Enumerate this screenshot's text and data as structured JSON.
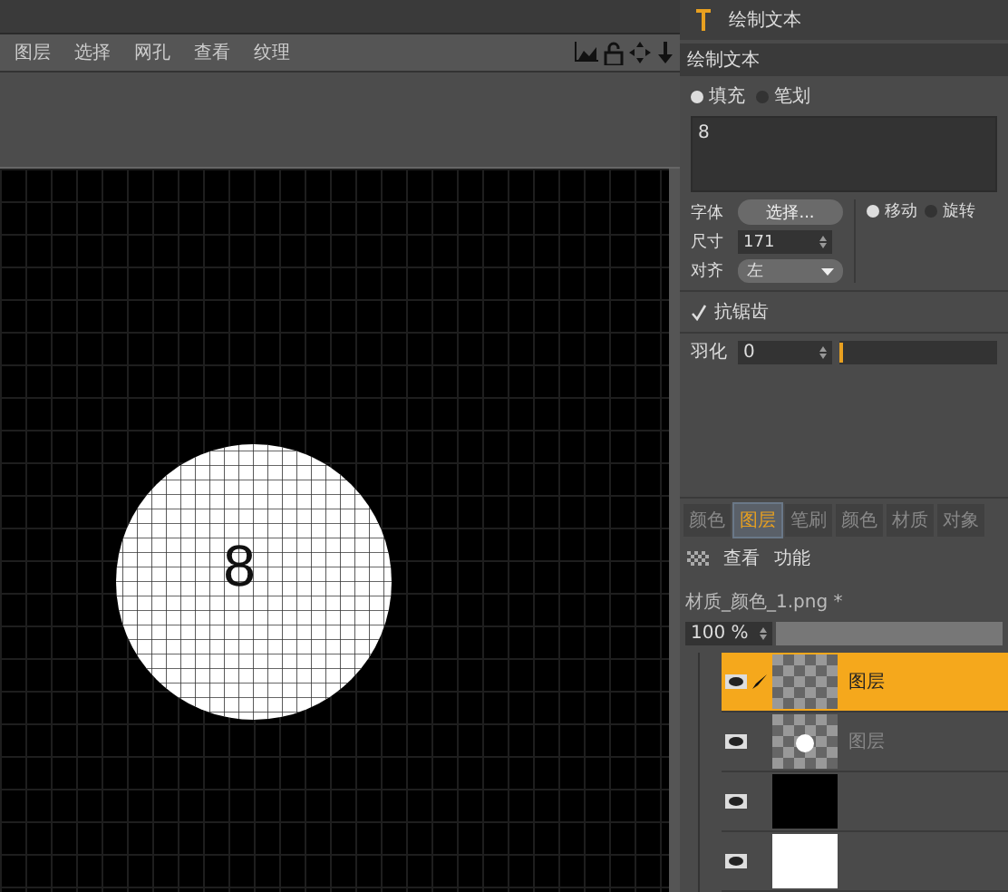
{
  "menu": [
    "图层",
    "选择",
    "网孔",
    "查看",
    "纹理"
  ],
  "canvas_text": "8",
  "panel": {
    "title": "绘制文本",
    "section": "绘制文本",
    "mode_options": [
      {
        "label": "填充",
        "selected": true
      },
      {
        "label": "笔划",
        "selected": false
      }
    ],
    "text": "8",
    "font_label": "字体",
    "font_button": "选择...",
    "transform_options": [
      {
        "label": "移动",
        "selected": true
      },
      {
        "label": "旋转",
        "selected": false
      }
    ],
    "size_label": "尺寸",
    "size": "171",
    "align_label": "对齐",
    "align": "左",
    "antialias": {
      "label": "抗锯齿",
      "checked": true
    },
    "feather_label": "羽化",
    "feather": "0",
    "feather_level": {
      "level": 0
    }
  },
  "layers_panel": {
    "tabs": [
      {
        "label": "颜色",
        "selected": false
      },
      {
        "label": "图层",
        "selected": true
      },
      {
        "label": "笔刷",
        "selected": false
      },
      {
        "label": "颜色",
        "selected": false
      },
      {
        "label": "材质",
        "selected": false
      },
      {
        "label": "对象",
        "selected": false
      }
    ],
    "menu": [
      "查看",
      "功能"
    ],
    "file": "材质_颜色_1.png *",
    "zoom": "100 %",
    "layers": [
      {
        "name": "图层",
        "selected": true,
        "kind": "checker"
      },
      {
        "name": "图层",
        "selected": false,
        "kind": "dot"
      },
      {
        "selected": false,
        "kind": "black"
      },
      {
        "selected": false,
        "kind": "white"
      }
    ]
  }
}
